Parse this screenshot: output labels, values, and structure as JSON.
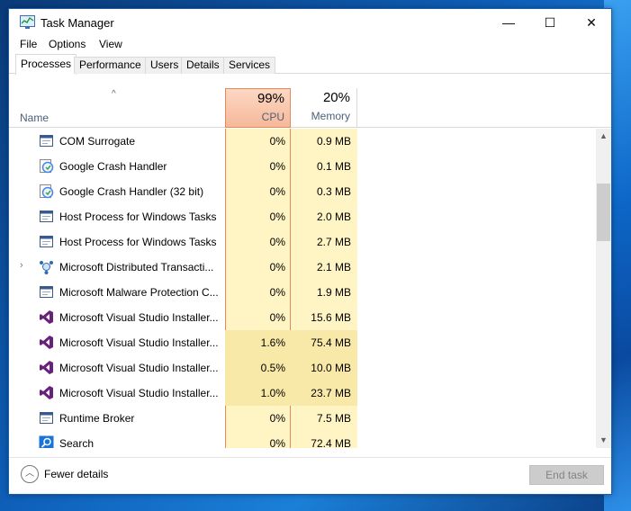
{
  "window": {
    "title": "Task Manager",
    "controls": {
      "minimize": "—",
      "maximize": "☐",
      "close": "✕"
    }
  },
  "menu": {
    "file": "File",
    "options": "Options",
    "view": "View"
  },
  "tabs": [
    {
      "label": "Processes",
      "active": true
    },
    {
      "label": "Performance"
    },
    {
      "label": "Users"
    },
    {
      "label": "Details"
    },
    {
      "label": "Services"
    }
  ],
  "columns": {
    "name": "Name",
    "sort_indicator": "^",
    "cpu": {
      "percent": "99%",
      "label": "CPU"
    },
    "memory": {
      "percent": "20%",
      "label": "Memory"
    }
  },
  "processes": [
    {
      "name": "COM Surrogate",
      "icon": "window-icon",
      "cpu": "0%",
      "memory": "0.9 MB",
      "expandable": false,
      "highlight": false
    },
    {
      "name": "Google Crash Handler",
      "icon": "google-update-icon",
      "cpu": "0%",
      "memory": "0.1 MB",
      "expandable": false,
      "highlight": false
    },
    {
      "name": "Google Crash Handler (32 bit)",
      "icon": "google-update-icon",
      "cpu": "0%",
      "memory": "0.3 MB",
      "expandable": false,
      "highlight": false
    },
    {
      "name": "Host Process for Windows Tasks",
      "icon": "window-icon",
      "cpu": "0%",
      "memory": "2.0 MB",
      "expandable": false,
      "highlight": false
    },
    {
      "name": "Host Process for Windows Tasks",
      "icon": "window-icon",
      "cpu": "0%",
      "memory": "2.7 MB",
      "expandable": false,
      "highlight": false
    },
    {
      "name": "Microsoft Distributed Transacti...",
      "icon": "network-icon",
      "cpu": "0%",
      "memory": "2.1 MB",
      "expandable": true,
      "highlight": false
    },
    {
      "name": "Microsoft Malware Protection C...",
      "icon": "window-icon",
      "cpu": "0%",
      "memory": "1.9 MB",
      "expandable": false,
      "highlight": false
    },
    {
      "name": "Microsoft Visual Studio Installer...",
      "icon": "visual-studio-icon",
      "cpu": "0%",
      "memory": "15.6 MB",
      "expandable": false,
      "highlight": false
    },
    {
      "name": "Microsoft Visual Studio Installer...",
      "icon": "visual-studio-icon",
      "cpu": "1.6%",
      "memory": "75.4 MB",
      "expandable": false,
      "highlight": true
    },
    {
      "name": "Microsoft Visual Studio Installer...",
      "icon": "visual-studio-icon",
      "cpu": "0.5%",
      "memory": "10.0 MB",
      "expandable": false,
      "highlight": true
    },
    {
      "name": "Microsoft Visual Studio Installer...",
      "icon": "visual-studio-icon",
      "cpu": "1.0%",
      "memory": "23.7 MB",
      "expandable": false,
      "highlight": true
    },
    {
      "name": "Runtime Broker",
      "icon": "window-icon",
      "cpu": "0%",
      "memory": "7.5 MB",
      "expandable": false,
      "highlight": false
    },
    {
      "name": "Search",
      "icon": "search-icon",
      "cpu": "0%",
      "memory": "72.4 MB",
      "expandable": false,
      "highlight": false
    }
  ],
  "footer": {
    "fewer_details": "Fewer details",
    "end_task": "End task"
  },
  "colors": {
    "cpu_header": "#f6b89a",
    "cpu_cell": "#fff4c4",
    "cpu_hot": "#f9e9a8",
    "accent": "#1b5fb0",
    "vs_purple": "#68217a"
  }
}
